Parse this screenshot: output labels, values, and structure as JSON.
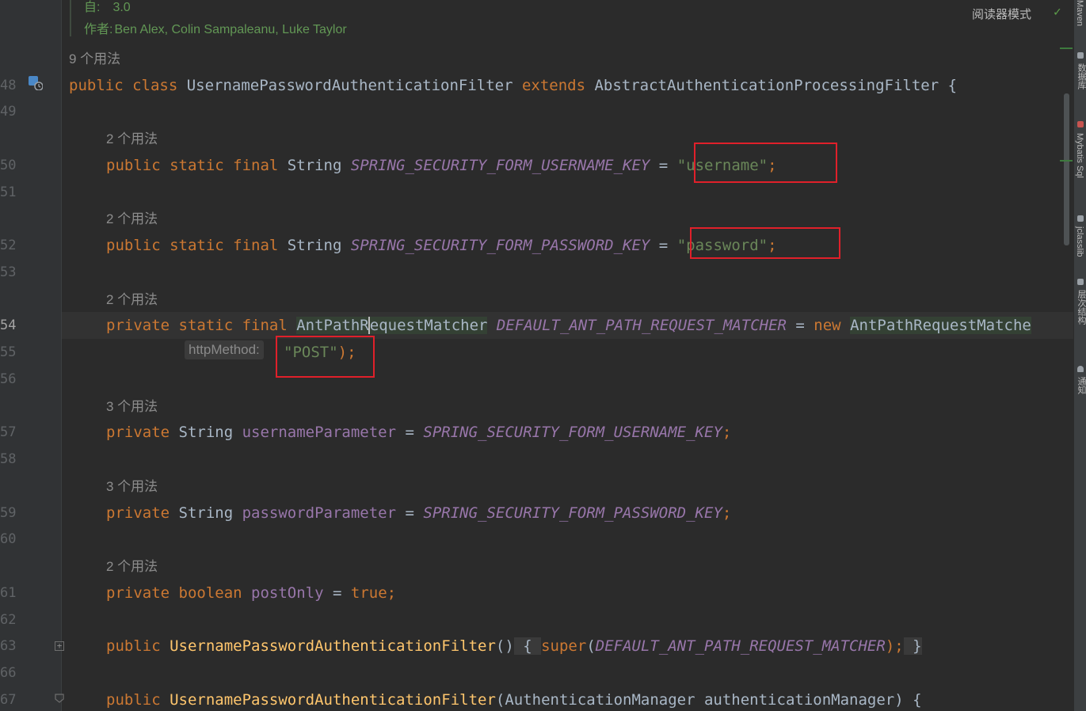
{
  "toolbar": {
    "reader_mode": "阅读器模式"
  },
  "doc": {
    "since_label": "自:",
    "since_value": "3.0",
    "authors_label": "作者:",
    "authors": "Ben Alex, Colin Sampaleanu, Luke Taylor"
  },
  "usages": {
    "class": "9 个用法",
    "l50": "2 个用法",
    "l52": "2 个用法",
    "l54": "2 个用法",
    "l57": "3 个用法",
    "l59": "3 个用法",
    "l61": "2 个用法"
  },
  "line_numbers": [
    "48",
    "49",
    "50",
    "51",
    "52",
    "53",
    "54",
    "55",
    "56",
    "57",
    "58",
    "59",
    "60",
    "61",
    "62",
    "63",
    "66",
    "67"
  ],
  "code": {
    "l48": {
      "kw1": "public class",
      "name": " UsernamePasswordAuthenticationFilter ",
      "kw2": "extends",
      "rest": " AbstractAuthenticationProcessingFilter {"
    },
    "l50": {
      "kw": "public static final",
      "type": " String ",
      "const": "SPRING_SECURITY_FORM_USERNAME_KEY",
      "eq": " = ",
      "str": "\"username\"",
      "semi": ";"
    },
    "l52": {
      "kw": "public static final",
      "type": " String ",
      "const": "SPRING_SECURITY_FORM_PASSWORD_KEY",
      "eq": " = ",
      "str": "\"password\"",
      "semi": ";"
    },
    "l54": {
      "kw": "private static final",
      "type_a": "AntPathR",
      "type_b": "equestMatcher",
      "const": "DEFAULT_ANT_PATH_REQUEST_MATCHER",
      "eq": " = ",
      "kwnew": "new",
      "ctor": "AntPathRequestMatche"
    },
    "l55": {
      "hint": "httpMethod:",
      "str": "\"POST\"",
      "rest": ");"
    },
    "l57": {
      "kw": "private",
      "type": " String ",
      "field": "usernameParameter",
      "eq": " = ",
      "const": "SPRING_SECURITY_FORM_USERNAME_KEY",
      "semi": ";"
    },
    "l59": {
      "kw": "private",
      "type": " String ",
      "field": "passwordParameter",
      "eq": " = ",
      "const": "SPRING_SECURITY_FORM_PASSWORD_KEY",
      "semi": ";"
    },
    "l61": {
      "kw": "private boolean",
      "field": " postOnly",
      "eq": " = ",
      "val": "true",
      "semi": ";"
    },
    "l63": {
      "kw": "public",
      "fn": " UsernamePasswordAuthenticationFilter",
      "paren": "()",
      "open": " { ",
      "kwsuper": "super",
      "p1": "(",
      "const": "DEFAULT_ANT_PATH_REQUEST_MATCHER",
      "p2": ");",
      "close": " }"
    },
    "l67": {
      "kw": "public",
      "fn": " UsernamePasswordAuthenticationFilter",
      "args": "(AuthenticationManager authenticationManager) {"
    }
  },
  "sidebar": {
    "maven": "Maven",
    "database": "数据库",
    "mybatis": "Mybatis Sql",
    "jclasslib": "jclasslib",
    "structure": "层次结构",
    "notifications": "通知"
  },
  "colors": {
    "background": "#2b2b2b",
    "keyword": "#cc7832",
    "string": "#6a8759",
    "constant": "#9876aa",
    "method": "#ffc66d",
    "highlight_box": "#e0202a"
  }
}
